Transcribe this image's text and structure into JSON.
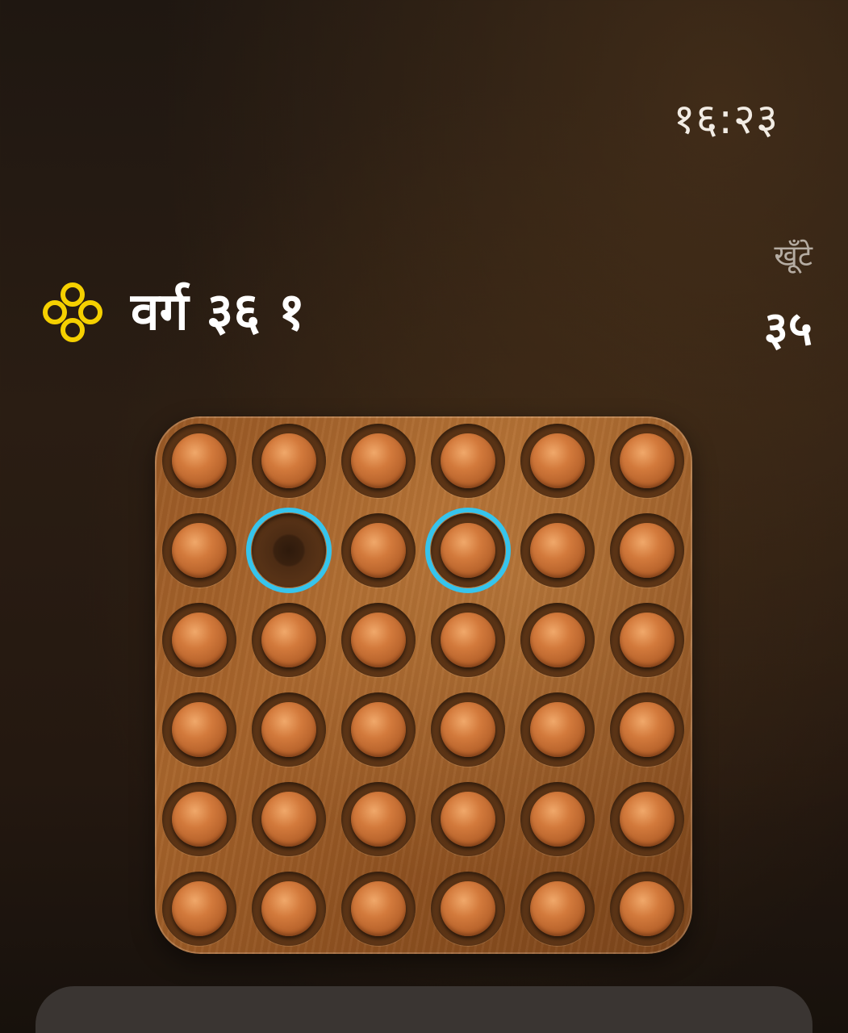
{
  "status": {
    "time": "१६:२३"
  },
  "header": {
    "level_icon": "four-circles-icon",
    "level_title": "वर्ग ३६ १",
    "pegs_label": "खूँटे",
    "pegs_count": "३५"
  },
  "colors": {
    "accent_yellow": "#f5d000",
    "selection_ring": "#36c4ec",
    "board": "#a0602a",
    "peg": "#d37a3c"
  },
  "board": {
    "rows": 6,
    "cols": 6,
    "grid": [
      [
        1,
        1,
        1,
        1,
        1,
        1
      ],
      [
        1,
        0,
        1,
        1,
        1,
        1
      ],
      [
        1,
        1,
        1,
        1,
        1,
        1
      ],
      [
        1,
        1,
        1,
        1,
        1,
        1
      ],
      [
        1,
        1,
        1,
        1,
        1,
        1
      ],
      [
        1,
        1,
        1,
        1,
        1,
        1
      ]
    ],
    "highlighted": [
      [
        1,
        1
      ],
      [
        1,
        3
      ]
    ]
  }
}
